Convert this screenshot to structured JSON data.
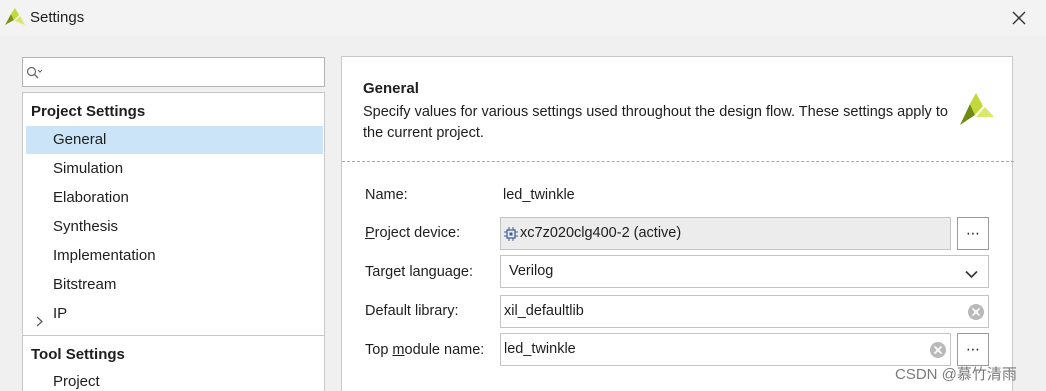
{
  "window": {
    "title": "Settings"
  },
  "search": {
    "placeholder": ""
  },
  "project_settings": {
    "header": "Project Settings",
    "items": [
      {
        "label": "General",
        "selected": true
      },
      {
        "label": "Simulation"
      },
      {
        "label": "Elaboration"
      },
      {
        "label": "Synthesis"
      },
      {
        "label": "Implementation"
      },
      {
        "label": "Bitstream"
      },
      {
        "label": "IP",
        "expandable": true
      }
    ]
  },
  "tool_settings": {
    "header": "Tool Settings",
    "items": [
      {
        "label": "Project"
      }
    ]
  },
  "general": {
    "title": "General",
    "description": "Specify values for various settings used throughout the design flow. These settings apply to the current project."
  },
  "form": {
    "name_label": "Name:",
    "name_value": "led_twinkle",
    "device_label_prefix": "",
    "device_label_underlined": "P",
    "device_label_rest": "roject device:",
    "device_value": "xc7z020clg400-2 (active)",
    "language_label": "Target language:",
    "language_value": "Verilog",
    "library_label": "Default library:",
    "library_value": "xil_defaultlib",
    "top_label_prefix": "Top ",
    "top_label_underlined": "m",
    "top_label_rest": "odule name:",
    "top_value": "led_twinkle",
    "more_label": "⋯"
  },
  "watermark": "CSDN @慕竹清雨",
  "colors": {
    "selection": "#cce4f7",
    "logo_dark": "#6f8a12",
    "logo_light": "#c4d83a"
  }
}
